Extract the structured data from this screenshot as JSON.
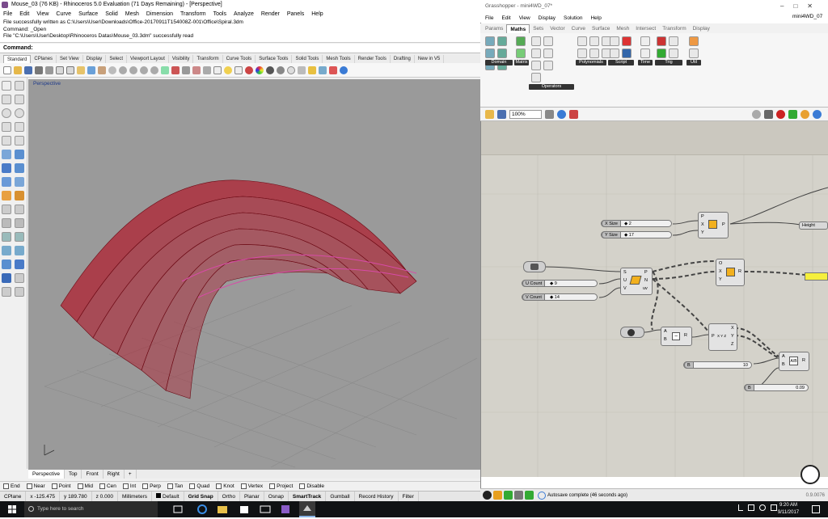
{
  "rhino": {
    "title": "Mouse_03 (76 KB) - Rhinoceros 5.0 Evaluation (71 Days Remaining) - [Perspective]",
    "menu": [
      "File",
      "Edit",
      "View",
      "Curve",
      "Surface",
      "Solid",
      "Mesh",
      "Dimension",
      "Transform",
      "Tools",
      "Analyze",
      "Render",
      "Panels",
      "Help"
    ],
    "history": [
      "File successfully written as C:\\Users\\User\\Downloads\\Office-20170911T154008Z-001\\Office\\Spiral.3dm",
      "Command: _Open",
      "File \"C:\\Users\\User\\Desktop\\Rhinoceros Datas\\Mouse_03.3dm\" successfully read"
    ],
    "command_label": "Command:",
    "toolbar_tabs": [
      "Standard",
      "CPlanes",
      "Set View",
      "Display",
      "Select",
      "Viewport Layout",
      "Visibility",
      "Transform",
      "Curve Tools",
      "Surface Tools",
      "Solid Tools",
      "Mesh Tools",
      "Render Tools",
      "Drafting",
      "New in V5"
    ],
    "viewport_label": "Perspective",
    "viewport_tabs": [
      "Perspective",
      "Top",
      "Front",
      "Right"
    ],
    "add_tab_symbol": "+",
    "osnaps": [
      "End",
      "Near",
      "Point",
      "Mid",
      "Cen",
      "Int",
      "Perp",
      "Tan",
      "Quad",
      "Knot",
      "Vertex",
      "Project",
      "Disable"
    ],
    "status": {
      "cplane": "CPlane",
      "x": "x -125.475",
      "y": "y 189.780",
      "z": "z 0.000",
      "units": "Millimeters",
      "layer": "Default",
      "buttons": [
        "Grid Snap",
        "Ortho",
        "Planar",
        "Osnap",
        "SmartTrack",
        "Gumball",
        "Record History",
        "Filter"
      ]
    }
  },
  "grasshopper": {
    "title": "Grasshopper - mini4WD_07*",
    "menu": [
      "File",
      "Edit",
      "View",
      "Display",
      "Solution",
      "Help"
    ],
    "file_label": "mini4WD_07",
    "tabs": [
      "Params",
      "Maths",
      "Sets",
      "Vector",
      "Curve",
      "Surface",
      "Mesh",
      "Intersect",
      "Transform",
      "Display"
    ],
    "active_tab": "Maths",
    "ribbon_groups": [
      "Domain",
      "Matrix",
      "Operators",
      "Polynomials",
      "Script",
      "Time",
      "Trig",
      "Util"
    ],
    "zoom": "100%",
    "components": {
      "xsize": {
        "label": "X Size",
        "value": "◆ 2"
      },
      "ysize": {
        "label": "Y Size",
        "value": "◆ 17"
      },
      "ucount": {
        "label": "U Count",
        "value": "◆ 9"
      },
      "vcount": {
        "label": "V Count",
        "value": "◆ 14"
      },
      "height": {
        "label": "Height"
      },
      "slider_a": {
        "value": "10"
      },
      "slider_b": {
        "value": "0.09"
      },
      "rect_ports_in": [
        "P",
        "X",
        "Y"
      ],
      "rect_ports_out": [
        "P"
      ],
      "srf_ports_in": [
        "S",
        "U",
        "V"
      ],
      "srf_ports_out": [
        "P",
        "N",
        "uv"
      ],
      "box_ports_in": [
        "O",
        "X",
        "Y"
      ],
      "box_ports_out": [
        "R"
      ],
      "sub_ports_in": [
        "A",
        "B"
      ],
      "sub_ports_out": [
        "R"
      ],
      "dec_ports_in": [
        "P"
      ],
      "dec_ports_out": [
        "X",
        "Y",
        "Z"
      ],
      "dec_label": "X Y Z",
      "div_ports_in": [
        "A",
        "B"
      ],
      "div_ports_out": [
        "R"
      ],
      "div_symbol": "A/B",
      "slider_letter": "B",
      "sub_symbol": "−"
    },
    "status_text": "Autosave complete (46 seconds ago)",
    "version": "0.9.0076"
  },
  "taskbar": {
    "search_placeholder": "Type here to search",
    "time": "9:20 AM",
    "date": "9/11/2017"
  },
  "colors": {
    "rhino_bg": "#f0f0f0",
    "viewport": "#9a9a9a",
    "mesh_red": "#b0182a",
    "gh_canvas": "#d4d2ca",
    "taskbar": "#101214"
  }
}
